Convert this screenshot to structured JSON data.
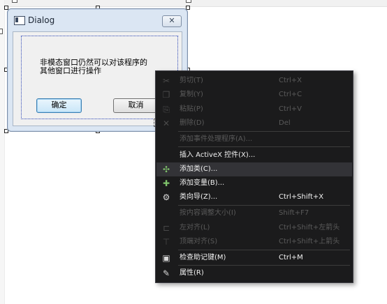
{
  "dialog": {
    "title": "Dialog",
    "close_glyph": "✕",
    "static_text": "非模态窗口仍然可以对该程序的\n其他窗口进行操作",
    "ok_label": "确定",
    "cancel_label": "取消"
  },
  "context_menu": {
    "items": [
      {
        "label": "剪切(T)",
        "shortcut": "Ctrl+X",
        "icon": "cut-icon",
        "enabled": false
      },
      {
        "label": "复制(Y)",
        "shortcut": "Ctrl+C",
        "icon": "copy-icon",
        "enabled": false
      },
      {
        "label": "粘贴(P)",
        "shortcut": "Ctrl+V",
        "icon": "paste-icon",
        "enabled": false
      },
      {
        "label": "删除(D)",
        "shortcut": "Del",
        "icon": "delete-icon",
        "enabled": false
      },
      {
        "label": "添加事件处理程序(A)...",
        "shortcut": "",
        "icon": "",
        "enabled": false
      },
      {
        "label": "插入 ActiveX 控件(X)...",
        "shortcut": "",
        "icon": "",
        "enabled": true
      },
      {
        "label": "添加类(C)...",
        "shortcut": "",
        "icon": "add-class-icon",
        "enabled": true,
        "highlighted": true
      },
      {
        "label": "添加变量(B)...",
        "shortcut": "",
        "icon": "add-variable-icon",
        "enabled": true
      },
      {
        "label": "类向导(Z)...",
        "shortcut": "Ctrl+Shift+X",
        "icon": "class-wizard-icon",
        "enabled": true
      },
      {
        "label": "按内容调整大小(I)",
        "shortcut": "Shift+F7",
        "icon": "",
        "enabled": false
      },
      {
        "label": "左对齐(L)",
        "shortcut": "Ctrl+Shift+左箭头",
        "icon": "align-left-icon",
        "enabled": false
      },
      {
        "label": "顶端对齐(S)",
        "shortcut": "Ctrl+Shift+上箭头",
        "icon": "align-top-icon",
        "enabled": false
      },
      {
        "label": "检查助记键(M)",
        "shortcut": "Ctrl+M",
        "icon": "check-mnemonics-icon",
        "enabled": true
      },
      {
        "label": "属性(R)",
        "shortcut": "",
        "icon": "properties-icon",
        "enabled": true
      }
    ]
  }
}
